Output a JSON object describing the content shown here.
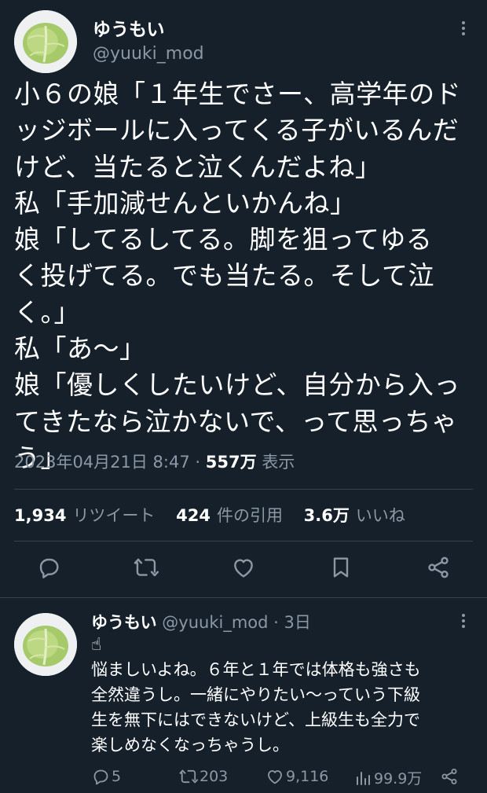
{
  "tweet": {
    "author_name": "ゆうもい",
    "author_handle": "@yuuki_mod",
    "lines": [
      "小６の娘「１年生でさー、高学年のド",
      "ッジボールに入ってくる子がいるんだ",
      "けど、当たると泣くんだよね」",
      "私「手加減せんといかんね」",
      "娘「してるしてる。脚を狙ってゆる",
      "く投げてる。でも当たる。そして泣",
      "く。」",
      "私「あ～」",
      "娘「優しくしたいけど、自分から入っ",
      "てきたなら泣かないで、って思っちゃ",
      "う」"
    ],
    "timestamp": "2023年04月21日 8:47",
    "views_count": "557万",
    "views_label": "表示",
    "separator": "·",
    "retweets_count": "1,934",
    "retweets_label": "リツイート",
    "quotes_count": "424",
    "quotes_label": "件の引用",
    "likes_count": "3.6万",
    "likes_label": "いいね"
  },
  "reply": {
    "author_name": "ゆうもい",
    "author_handle": "@yuuki_mod",
    "separator": "·",
    "time": "3日",
    "emoji": "☝",
    "lines": [
      "悩ましいよね。６年と１年では体格も強さも",
      "全然違うし。一緒にやりたい～っていう下級",
      "生を無下にはできないけど、上級生も全力で",
      "楽しめなくなっちゃうし。"
    ],
    "replies": "5",
    "retweets": "203",
    "likes": "9,116",
    "views": "99.9万"
  },
  "colors": {
    "background": "#15202b",
    "text": "#ffffff",
    "muted": "#8b98a5",
    "divider": "#38444d",
    "avatar_leaf": "#a6c96a"
  }
}
